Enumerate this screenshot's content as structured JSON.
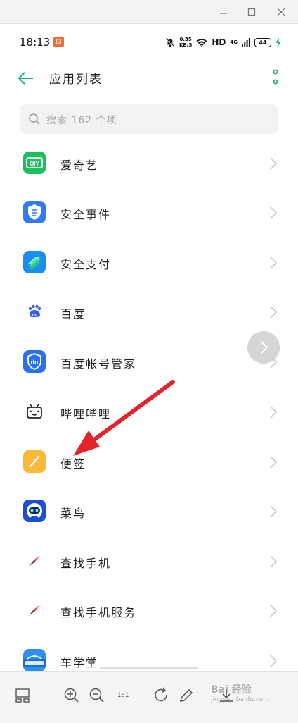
{
  "status_bar": {
    "time": "18:13",
    "app_badge": "⊡",
    "net_speed_value": "0.35",
    "net_speed_unit": "KB/S",
    "hd": "HD",
    "network": "4G",
    "battery": "44"
  },
  "header": {
    "title": "应用列表"
  },
  "search": {
    "placeholder": "搜索 162 个项"
  },
  "apps": [
    {
      "name": "爱奇艺",
      "icon": "iqiyi-icon"
    },
    {
      "name": "安全事件",
      "icon": "security-event-icon"
    },
    {
      "name": "安全支付",
      "icon": "secure-pay-icon"
    },
    {
      "name": "百度",
      "icon": "baidu-icon"
    },
    {
      "name": "百度帐号管家",
      "icon": "baidu-account-icon"
    },
    {
      "name": "哔哩哔哩",
      "icon": "bilibili-icon"
    },
    {
      "name": "便签",
      "icon": "notes-icon"
    },
    {
      "name": "菜鸟",
      "icon": "cainiao-icon"
    },
    {
      "name": "查找手机",
      "icon": "find-phone-icon"
    },
    {
      "name": "查找手机服务",
      "icon": "find-phone-service-icon"
    },
    {
      "name": "车学堂",
      "icon": "chexuetang-icon"
    }
  ],
  "toolbar": {
    "actual_size": "1:1"
  },
  "watermark": {
    "text": "Bai 经验",
    "sub": "jingyan.baidu.com"
  },
  "colors": {
    "accent": "#1fb07a",
    "annotation": "#e3222b"
  }
}
